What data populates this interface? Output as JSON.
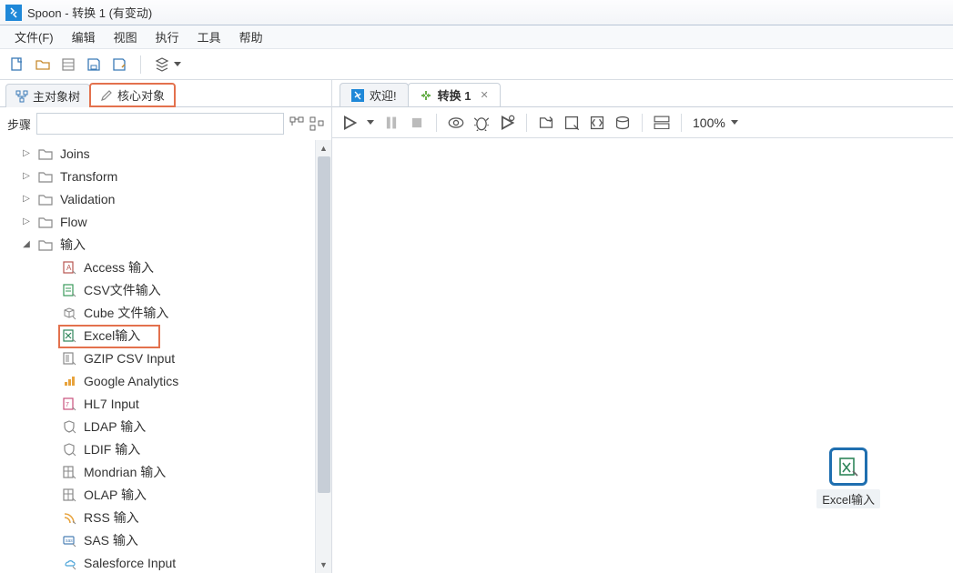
{
  "window": {
    "title": "Spoon - 转换 1 (有变动)"
  },
  "menu": {
    "file": "文件(F)",
    "edit": "编辑",
    "view": "视图",
    "run": "执行",
    "tools": "工具",
    "help": "帮助"
  },
  "sidebar": {
    "tab_main": "主对象树",
    "tab_core": "核心对象",
    "filter_label": "步骤",
    "folders": {
      "joins": "Joins",
      "transform": "Transform",
      "validation": "Validation",
      "flow": "Flow",
      "input": "输入"
    },
    "input_items": [
      "Access 输入",
      "CSV文件输入",
      "Cube 文件输入",
      "Excel输入",
      "GZIP CSV Input",
      "Google Analytics",
      "HL7 Input",
      "LDAP 输入",
      "LDIF 输入",
      "Mondrian 输入",
      "OLAP 输入",
      "RSS 输入",
      "SAS 输入",
      "Salesforce Input"
    ]
  },
  "editor": {
    "tab_welcome": "欢迎!",
    "tab_trans": "转换 1",
    "zoom": "100%"
  },
  "canvas": {
    "step_label": "Excel输入"
  }
}
